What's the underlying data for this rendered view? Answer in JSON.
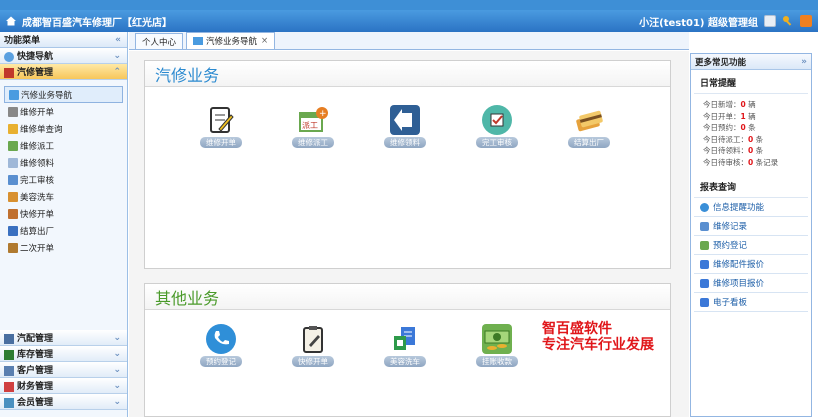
{
  "header": {
    "title": "成都智百盛汽车修理厂【红光店】",
    "user": "小汪(test01) 超级管理组"
  },
  "sidebar": {
    "title": "功能菜单",
    "quick_nav": "快捷导航",
    "repair_mgmt": "汽修管理",
    "items": [
      {
        "label": "汽修业务导航"
      },
      {
        "label": "维修开单"
      },
      {
        "label": "维修单查询"
      },
      {
        "label": "维修派工"
      },
      {
        "label": "维修领料"
      },
      {
        "label": "完工审核"
      },
      {
        "label": "美容洗车"
      },
      {
        "label": "快修开单"
      },
      {
        "label": "结算出厂"
      },
      {
        "label": "二次开单"
      }
    ],
    "bottom": [
      {
        "label": "汽配管理"
      },
      {
        "label": "库存管理"
      },
      {
        "label": "客户管理"
      },
      {
        "label": "财务管理"
      },
      {
        "label": "会员管理"
      }
    ]
  },
  "tabs": [
    {
      "label": "个人中心"
    },
    {
      "label": "汽修业务导航"
    }
  ],
  "panel1": {
    "title": "汽修业务",
    "buttons": [
      {
        "label": "维修开单",
        "icon": "notepad-pencil-icon"
      },
      {
        "label": "维修派工",
        "icon": "dispatch-icon"
      },
      {
        "label": "维修领料",
        "icon": "arrow-left-icon"
      },
      {
        "label": "完工审核",
        "icon": "checkbox-icon"
      },
      {
        "label": "结算出厂",
        "icon": "cards-icon"
      }
    ]
  },
  "panel2": {
    "title": "其他业务",
    "buttons": [
      {
        "label": "预约登记",
        "icon": "phone-icon"
      },
      {
        "label": "快修开单",
        "icon": "clipboard-pencil-icon"
      },
      {
        "label": "美容洗车",
        "icon": "document-icon"
      },
      {
        "label": "挂账收款",
        "icon": "money-icon"
      }
    ],
    "promo_line1": "智百盛软件",
    "promo_line2": "专注汽车行业发展"
  },
  "right": {
    "title": "更多常见功能",
    "daily": "日常提醒",
    "stats": [
      {
        "label": "今日新增：",
        "value": "0",
        "unit": "辆"
      },
      {
        "label": "今日开单：",
        "value": "1",
        "unit": "辆"
      },
      {
        "label": "今日预约：",
        "value": "0",
        "unit": "条"
      },
      {
        "label": "今日待派工：",
        "value": "0",
        "unit": "条"
      },
      {
        "label": "今日待领料：",
        "value": "0",
        "unit": "条"
      },
      {
        "label": "今日待审核：",
        "value": "0",
        "unit": "条记录"
      }
    ],
    "reports": "报表查询",
    "links": [
      {
        "label": "信息提醒功能"
      },
      {
        "label": "维修记录"
      },
      {
        "label": "预约登记"
      },
      {
        "label": "维修配件报价"
      },
      {
        "label": "维修项目报价"
      },
      {
        "label": "电子看板"
      }
    ]
  },
  "colors": {
    "header": "#2b73c4",
    "panel1_title": "#2b8ad0",
    "panel2_title": "#4a9a2a",
    "accent_red": "#e0161a"
  }
}
